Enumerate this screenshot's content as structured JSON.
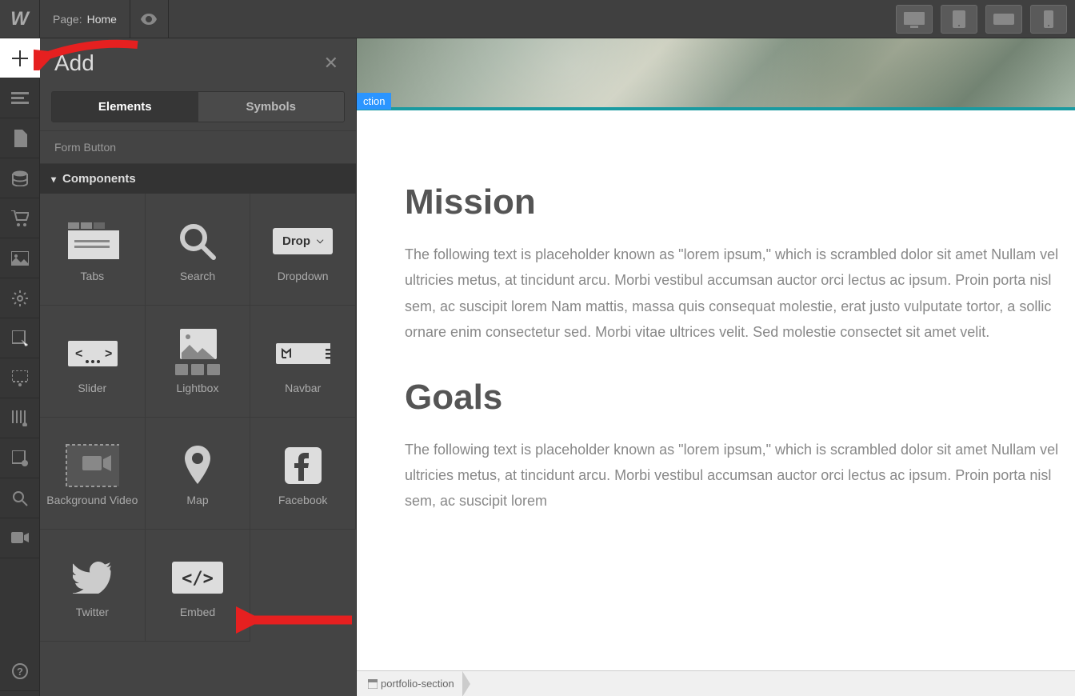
{
  "topbar": {
    "logo": "W",
    "page_label": "Page:",
    "page_name": "Home"
  },
  "panel": {
    "title": "Add",
    "tabs": {
      "elements": "Elements",
      "symbols": "Symbols"
    },
    "form_button": "Form Button",
    "section_components": "Components",
    "components": [
      {
        "label": "Tabs"
      },
      {
        "label": "Search"
      },
      {
        "label": "Dropdown",
        "btn_text": "Drop"
      },
      {
        "label": "Slider"
      },
      {
        "label": "Lightbox"
      },
      {
        "label": "Navbar"
      },
      {
        "label": "Background Video"
      },
      {
        "label": "Map"
      },
      {
        "label": "Facebook"
      },
      {
        "label": "Twitter"
      },
      {
        "label": "Embed"
      }
    ]
  },
  "canvas": {
    "badge": "ction",
    "heading1": "Mission",
    "para1": "The following text is placeholder known as \"lorem ipsum,\" which is scrambled dolor sit amet Nullam vel ultricies metus, at tincidunt arcu. Morbi vestibul accumsan auctor orci lectus ac ipsum. Proin porta nisl sem, ac suscipit lorem Nam mattis, massa quis consequat molestie, erat justo vulputate tortor, a sollic ornare enim consectetur sed. Morbi vitae ultrices velit. Sed molestie consectet sit amet velit.",
    "heading2": "Goals",
    "para2": "The following text is placeholder known as \"lorem ipsum,\" which is scrambled dolor sit amet Nullam vel ultricies metus, at tincidunt arcu. Morbi vestibul accumsan auctor orci lectus ac ipsum. Proin porta nisl sem, ac suscipit lorem",
    "breadcrumb": "portfolio-section"
  }
}
